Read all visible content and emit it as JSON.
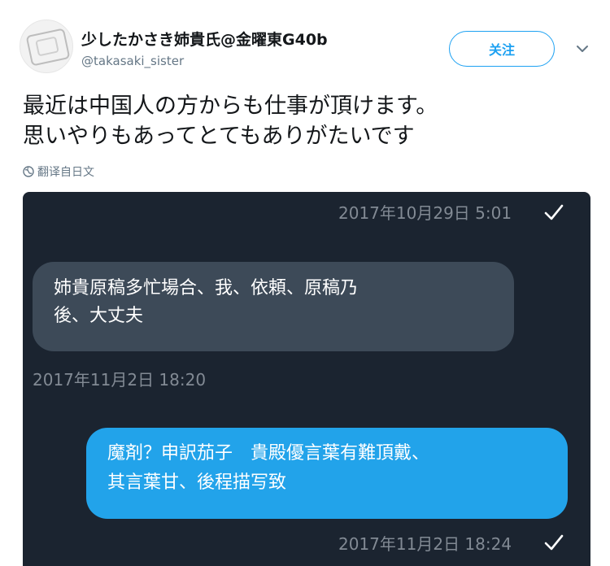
{
  "header": {
    "display_name": "少したかさき姉貴氏@金曜東G40b",
    "handle": "@takasaki_sister",
    "follow_label": "关注"
  },
  "tweet": {
    "lines": [
      "最近は中国人の方からも仕事が頂けます。",
      "思いやりもあってとてもありがたいです"
    ],
    "translate_label": "翻译自日文"
  },
  "chat": {
    "messages": [
      {
        "direction": "out",
        "timestamp": "2017年10月29日 5:01",
        "read": true
      },
      {
        "direction": "in",
        "lines": [
          "姉貴原稿多忙場合、我、依頼、原稿乃",
          "後、大丈夫"
        ],
        "timestamp": "2017年11月2日 18:20"
      },
      {
        "direction": "out",
        "lines": [
          "魔剤？申訳茄子　貴殿優言葉有難頂戴、",
          "其言葉甘、後程描写致"
        ],
        "timestamp": "2017年11月2日 18:24",
        "read": true
      }
    ]
  },
  "colors": {
    "accent": "#1da1f2",
    "chat_bg": "#1b2430",
    "incoming_bubble": "#3d4a58",
    "outgoing_bubble": "#22a3ea",
    "timestamp": "#828a94"
  },
  "icons": [
    "globe-icon",
    "chevron-down-icon",
    "checkmark-icon"
  ]
}
